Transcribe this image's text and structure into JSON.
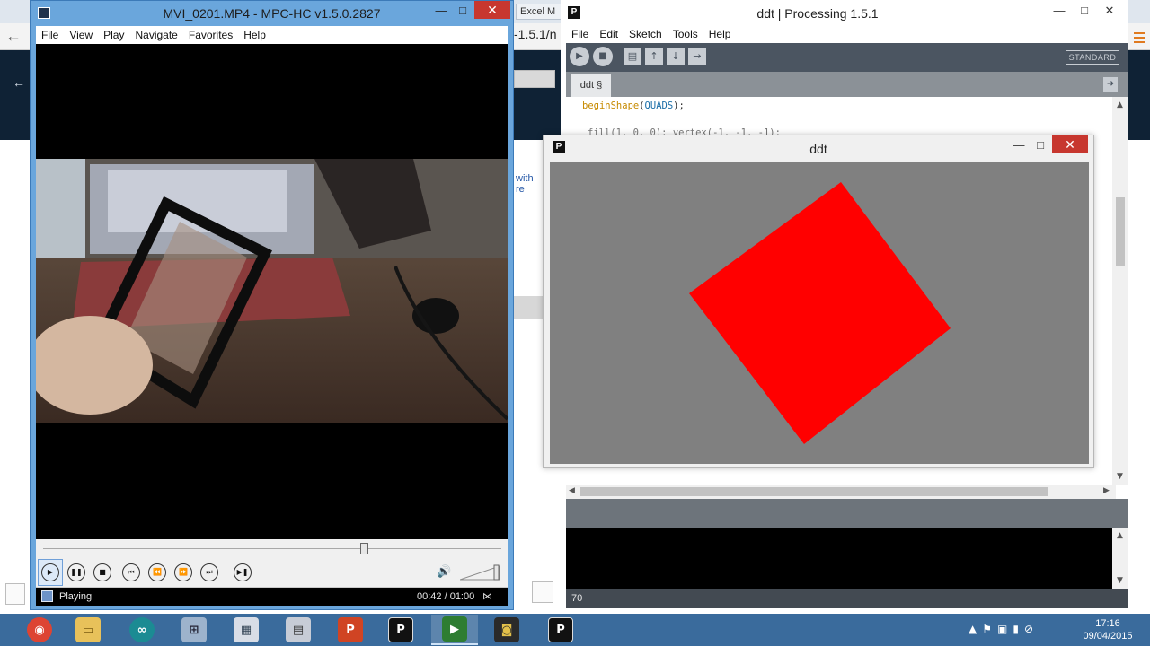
{
  "browser": {
    "excel_tab": "Excel M",
    "url_fragment": "-1.5.1/n",
    "side_text_1": "with",
    "side_text_2": "re"
  },
  "mpc": {
    "title": "MVI_0201.MP4 - MPC-HC v1.5.0.2827",
    "menu": [
      "File",
      "View",
      "Play",
      "Navigate",
      "Favorites",
      "Help"
    ],
    "seek_position": 0.7,
    "status": "Playing",
    "time": "00:42 / 01:00",
    "volume_level": 1.0
  },
  "ide": {
    "title": "ddt | Processing 1.5.1",
    "menu": [
      "File",
      "Edit",
      "Sketch",
      "Tools",
      "Help"
    ],
    "mode_label": "STANDARD",
    "tab_label": "ddt §",
    "code_line_1": {
      "fn": "beginShape",
      "arg": "QUADS",
      "tail": ");"
    },
    "code_line_2": "fill(1, 0, 0); vertex(-1, -1, -1);",
    "line_number": "70"
  },
  "sketch": {
    "title": "ddt",
    "square_color": "#ff0000",
    "background_color": "#808080",
    "rotation_deg": 37
  },
  "taskbar": {
    "apps": [
      "chrome-icon",
      "file-explorer-icon",
      "arduino-icon",
      "network-icon",
      "paint-icon",
      "calculator-icon",
      "powerpoint-icon",
      "processing-icon",
      "media-player-classic-icon",
      "camera-icon",
      "processing-icon"
    ],
    "time": "17:16",
    "date": "09/04/2015"
  }
}
